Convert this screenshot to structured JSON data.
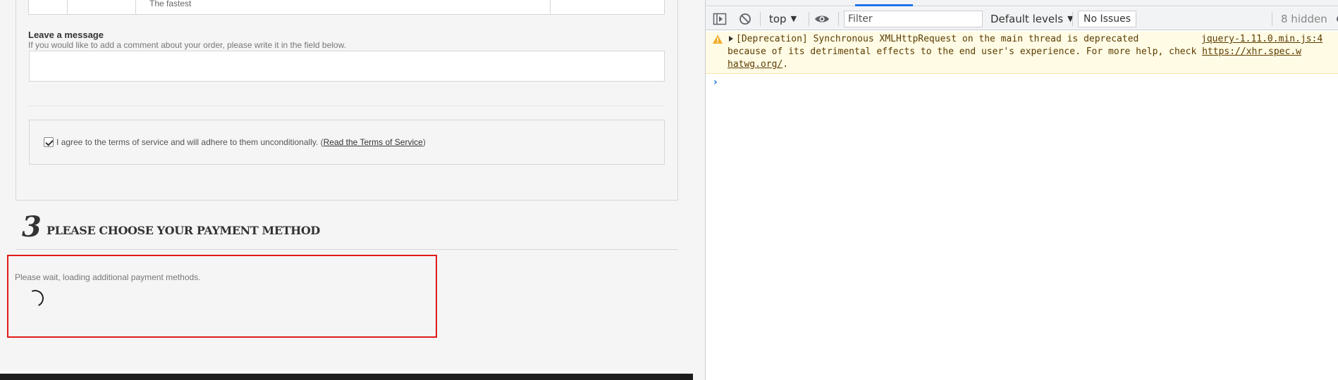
{
  "page": {
    "carrier_delay": "The fastest",
    "message": {
      "title": "Leave a message",
      "hint": "If you would like to add a comment about your order, please write it in the field below."
    },
    "terms": {
      "checked": true,
      "text": "I agree to the terms of service and will adhere to them unconditionally. (",
      "link": "Read the Terms of Service",
      "suffix": ")"
    },
    "payment_step": {
      "number": "3",
      "title": "PLEASE CHOOSE YOUR PAYMENT METHOD",
      "loading_text": "Please wait, loading additional payment methods."
    },
    "colors": {
      "highlight": "#e01a1a",
      "footer": "#1c1c1c"
    }
  },
  "devtools": {
    "toolbar": {
      "context": "top",
      "filter_placeholder": "Filter",
      "levels": "Default levels",
      "issues": "No Issues",
      "hidden": "8 hidden"
    },
    "console": {
      "warning": {
        "line1": "[Deprecation] Synchronous XMLHttpRequest on the main thread is deprecated",
        "source": "jquery-1.11.0.min.js:4",
        "line2": "because of its detrimental effects to the end user's experience. For more help, check ",
        "link_part1": "https://xhr.spec.w",
        "link_part2": "hatwg.org/",
        "line3_suffix": "."
      },
      "prompt_symbol": "›"
    },
    "icons": [
      "sidebar-toggle-icon",
      "clear-console-icon",
      "live-expression-eye-icon",
      "warning-triangle-icon",
      "settings-gear-icon"
    ],
    "colors": {
      "warning_bg": "#fffbe5",
      "accent": "#1a73e8"
    }
  }
}
